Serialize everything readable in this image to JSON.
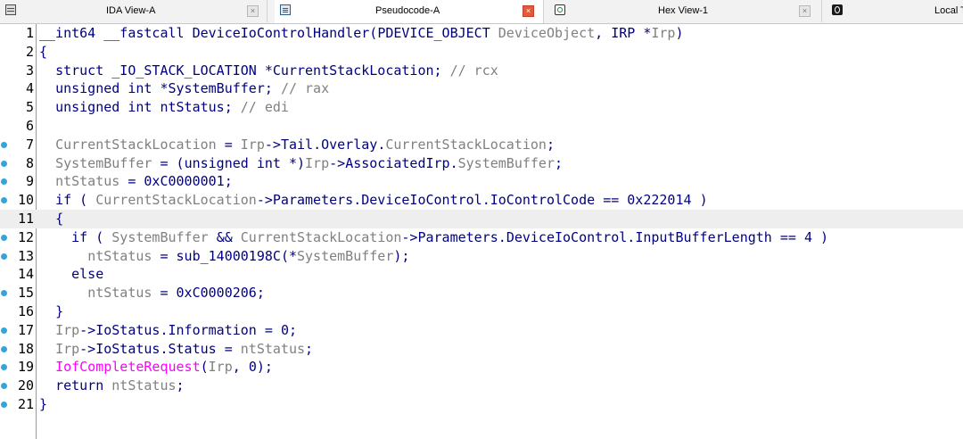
{
  "tabs": [
    {
      "label": "IDA View-A",
      "icon": "disassembly-icon",
      "active": false,
      "close_label": "×"
    },
    {
      "label": "Pseudocode-A",
      "icon": "pseudocode-icon",
      "active": true,
      "close_label": "×"
    },
    {
      "label": "Hex View-1",
      "icon": "hex-view-icon",
      "active": false,
      "close_label": "×"
    },
    {
      "label": "Local T",
      "icon": "local-types-icon",
      "active": false
    }
  ],
  "code_lines": [
    {
      "num": "1",
      "breakpoint": false,
      "text": "__int64 __fastcall DeviceIoControlHandler(PDEVICE_OBJECT DeviceObject, IRP *Irp)"
    },
    {
      "num": "2",
      "breakpoint": false,
      "text": "{"
    },
    {
      "num": "3",
      "breakpoint": false,
      "text": "  struct _IO_STACK_LOCATION *CurrentStackLocation; // rcx"
    },
    {
      "num": "4",
      "breakpoint": false,
      "text": "  unsigned int *SystemBuffer; // rax"
    },
    {
      "num": "5",
      "breakpoint": false,
      "text": "  unsigned int ntStatus; // edi"
    },
    {
      "num": "6",
      "breakpoint": false,
      "text": ""
    },
    {
      "num": "7",
      "breakpoint": true,
      "text": "  CurrentStackLocation = Irp->Tail.Overlay.CurrentStackLocation;"
    },
    {
      "num": "8",
      "breakpoint": true,
      "text": "  SystemBuffer = (unsigned int *)Irp->AssociatedIrp.SystemBuffer;"
    },
    {
      "num": "9",
      "breakpoint": true,
      "text": "  ntStatus = 0xC0000001;"
    },
    {
      "num": "10",
      "breakpoint": true,
      "text": "  if ( CurrentStackLocation->Parameters.DeviceIoControl.IoControlCode == 0x222014 )"
    },
    {
      "num": "11",
      "breakpoint": false,
      "text": "  {"
    },
    {
      "num": "12",
      "breakpoint": true,
      "text": "    if ( SystemBuffer && CurrentStackLocation->Parameters.DeviceIoControl.InputBufferLength == 4 )"
    },
    {
      "num": "13",
      "breakpoint": true,
      "text": "      ntStatus = sub_14000198C(*SystemBuffer);"
    },
    {
      "num": "14",
      "breakpoint": false,
      "text": "    else"
    },
    {
      "num": "15",
      "breakpoint": true,
      "text": "      ntStatus = 0xC0000206;"
    },
    {
      "num": "16",
      "breakpoint": false,
      "text": "  }"
    },
    {
      "num": "17",
      "breakpoint": true,
      "text": "  Irp->IoStatus.Information = 0;"
    },
    {
      "num": "18",
      "breakpoint": true,
      "text": "  Irp->IoStatus.Status = ntStatus;"
    },
    {
      "num": "19",
      "breakpoint": true,
      "text": "  IofCompleteRequest(Irp, 0);"
    },
    {
      "num": "20",
      "breakpoint": true,
      "text": "  return ntStatus;"
    },
    {
      "num": "21",
      "breakpoint": true,
      "text": "}"
    }
  ],
  "highlighted_line": "11",
  "colors": {
    "keyword": "#000080",
    "variable": "#808080",
    "comment": "#808080",
    "import_function": "#ff00ff",
    "breakpoint": "#33a4dc",
    "active_close": "#e25a3c"
  }
}
